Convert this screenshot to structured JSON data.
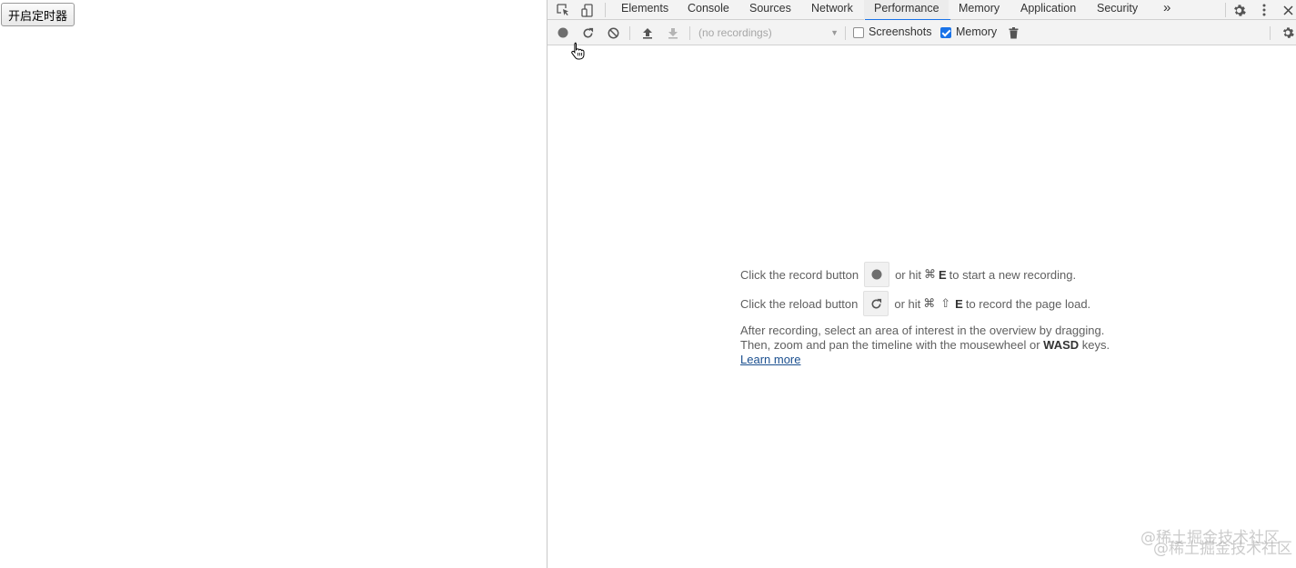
{
  "page": {
    "timer_button_label": "开启定时器"
  },
  "devtools": {
    "tabs": [
      {
        "label": "Elements"
      },
      {
        "label": "Console"
      },
      {
        "label": "Sources"
      },
      {
        "label": "Network"
      },
      {
        "label": "Performance",
        "active": true
      },
      {
        "label": "Memory"
      },
      {
        "label": "Application"
      },
      {
        "label": "Security"
      }
    ],
    "more_tabs_glyph": "»",
    "toolbar": {
      "recordings_value": "(no recordings)",
      "screenshots_label": "Screenshots",
      "screenshots_checked": false,
      "memory_label": "Memory",
      "memory_checked": true
    },
    "landing": {
      "record_prefix": "Click the record button",
      "record_suffix_pre": "or hit",
      "record_cmd_symbol": "⌘",
      "record_key": "E",
      "record_suffix_post": "to start a new recording.",
      "reload_prefix": "Click the reload button",
      "reload_suffix_pre": "or hit",
      "reload_cmd_symbol": "⌘",
      "reload_shift_symbol": "⇧",
      "reload_key": "E",
      "reload_suffix_post": "to record the page load.",
      "para_line1": "After recording, select an area of interest in the overview by dragging.",
      "para_line2_pre": "Then, zoom and pan the timeline with the mousewheel or",
      "para_line2_bold": "WASD",
      "para_line2_post": "keys.",
      "learn_more": "Learn more"
    },
    "colors": {
      "accent": "#1a73e8",
      "toolbar_bg": "#f3f3f3",
      "link": "#1a4f8f"
    }
  },
  "watermark": {
    "line1": "@稀土掘金技术社区",
    "line2": "@稀土掘金技术社区"
  }
}
